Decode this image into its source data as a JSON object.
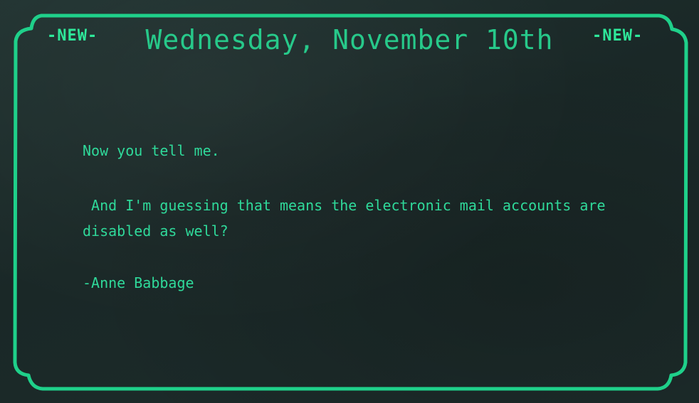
{
  "post": {
    "badge_left": "-NEW-",
    "badge_right": "-NEW-",
    "date_title": "Wednesday, November 10th",
    "paragraphs": [
      "Now you tell me.",
      " And I'm guessing that means the electronic mail accounts are disabled as well?",
      "-Anne Babbage"
    ]
  },
  "colors": {
    "frame": "#1fd08a",
    "text": "#2fd99a",
    "title": "#27c98a",
    "background": "#1c2b2a"
  }
}
